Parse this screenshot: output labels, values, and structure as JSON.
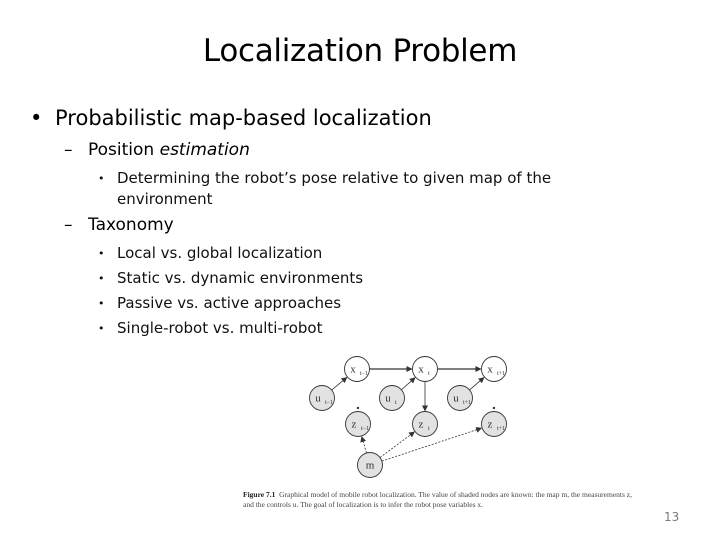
{
  "slide": {
    "title": "Localization Problem",
    "page_number": "13"
  },
  "content": {
    "level1": {
      "bullet": "•",
      "text": "Probabilistic map-based localization"
    },
    "position_estimation": {
      "dash": "–",
      "text_regular": "Position ",
      "text_italic": "estimation",
      "items": [
        "Determining the robot’s pose relative to given map of the environment"
      ]
    },
    "taxonomy": {
      "dash": "–",
      "text": "Taxonomy",
      "items": [
        "Local vs. global localization",
        "Static vs. dynamic environments",
        "Passive vs. active approaches",
        "Single-robot vs. multi-robot"
      ]
    }
  },
  "figure": {
    "caption_label": "Figure 7.1",
    "caption_text": "Graphical model of mobile robot localization. The value of shaded nodes are known: the map m, the measurements z, and the controls u. The goal of localization is to infer the robot pose variables x.",
    "nodes": {
      "x_prev": {
        "base": "x",
        "sub": "t−1",
        "shaded": false
      },
      "x_t": {
        "base": "x",
        "sub": "t",
        "shaded": false
      },
      "x_next": {
        "base": "x",
        "sub": "t+1",
        "shaded": false
      },
      "u_prev": {
        "base": "u",
        "sub": "t−1",
        "shaded": true
      },
      "u_t": {
        "base": "u",
        "sub": "t",
        "shaded": true
      },
      "u_next": {
        "base": "u",
        "sub": "t+1",
        "shaded": true
      },
      "z_prev": {
        "base": "z",
        "sub": "t−1",
        "shaded": true
      },
      "z_t": {
        "base": "z",
        "sub": "t",
        "shaded": true
      },
      "z_next": {
        "base": "z",
        "sub": "t+1",
        "shaded": true
      },
      "m": {
        "base": "m",
        "sub": "",
        "shaded": true
      }
    },
    "edges": [
      [
        "x_prev",
        "x_t"
      ],
      [
        "x_t",
        "x_next"
      ],
      [
        "u_prev",
        "x_prev"
      ],
      [
        "u_t",
        "x_t"
      ],
      [
        "u_next",
        "x_next"
      ],
      [
        "x_t",
        "z_t"
      ],
      [
        "m",
        "z_prev"
      ],
      [
        "m",
        "z_t"
      ],
      [
        "m",
        "z_next"
      ]
    ],
    "colors": {
      "shaded_fill": "#e2e2e2",
      "open_fill": "#ffffff",
      "stroke": "#333333"
    }
  }
}
